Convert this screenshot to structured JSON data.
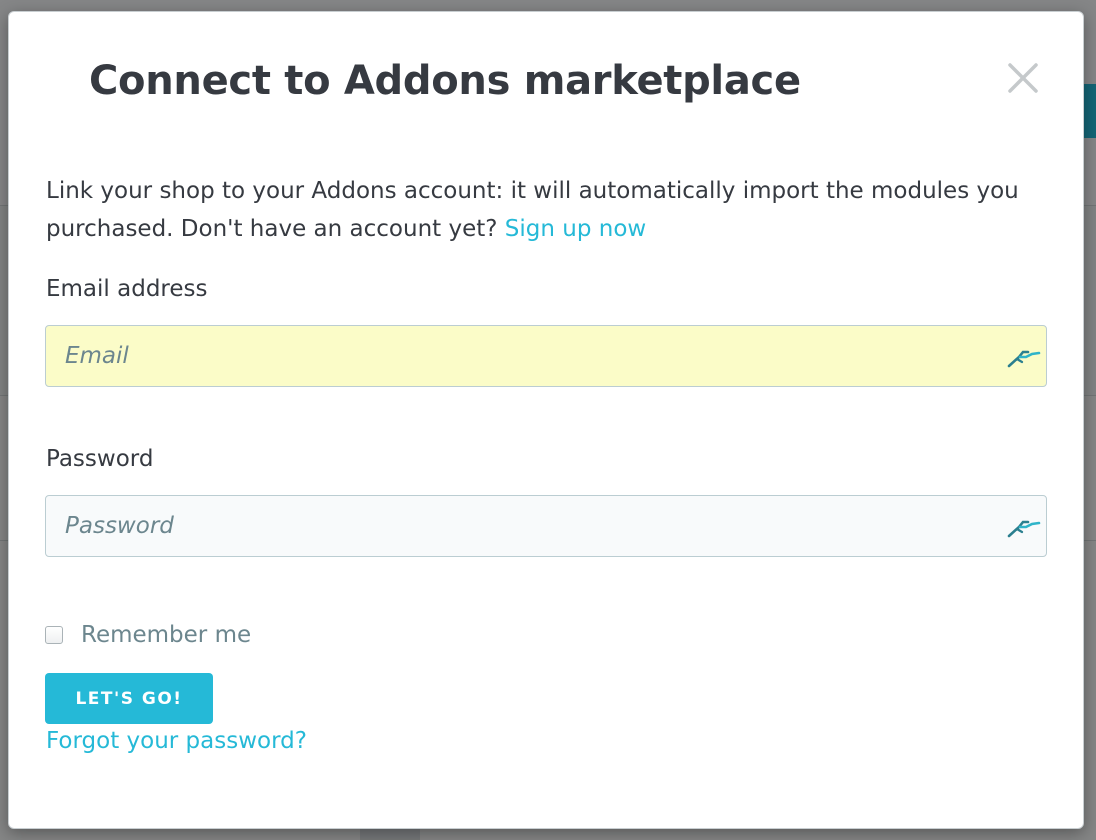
{
  "modal": {
    "title": "Connect to Addons marketplace",
    "close_icon": "close-icon",
    "intro_text": "Link your shop to your Addons account: it will automatically import the modules you purchased. Don't have an account yet? ",
    "signup_link": "Sign up now"
  },
  "form": {
    "email": {
      "label": "Email address",
      "placeholder": "Email",
      "value": "",
      "icon": "autofill-key-icon"
    },
    "password": {
      "label": "Password",
      "placeholder": "Password",
      "value": "",
      "icon": "autofill-key-icon"
    },
    "remember_label": "Remember me",
    "remember_checked": false,
    "submit_label": "LET'S GO!",
    "forgot_link": "Forgot your password?"
  },
  "colors": {
    "accent": "#25b9d7",
    "text": "#363a41",
    "muted": "#6c868e",
    "autofill_bg": "#fbfcc8"
  }
}
